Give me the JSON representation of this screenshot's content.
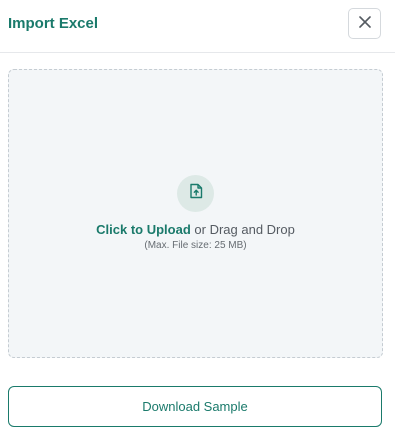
{
  "dialog": {
    "title": "Import Excel",
    "close_icon": "close-icon"
  },
  "dropzone": {
    "icon": "file-upload-icon",
    "click_label": "Click to Upload",
    "drag_label": " or Drag and Drop",
    "hint": "(Max. File size: 25 MB)"
  },
  "footer": {
    "download_label": "Download Sample"
  },
  "colors": {
    "accent": "#1a7a6b",
    "dropzone_bg": "#f3f6f8",
    "icon_bg": "#dde9e6"
  }
}
